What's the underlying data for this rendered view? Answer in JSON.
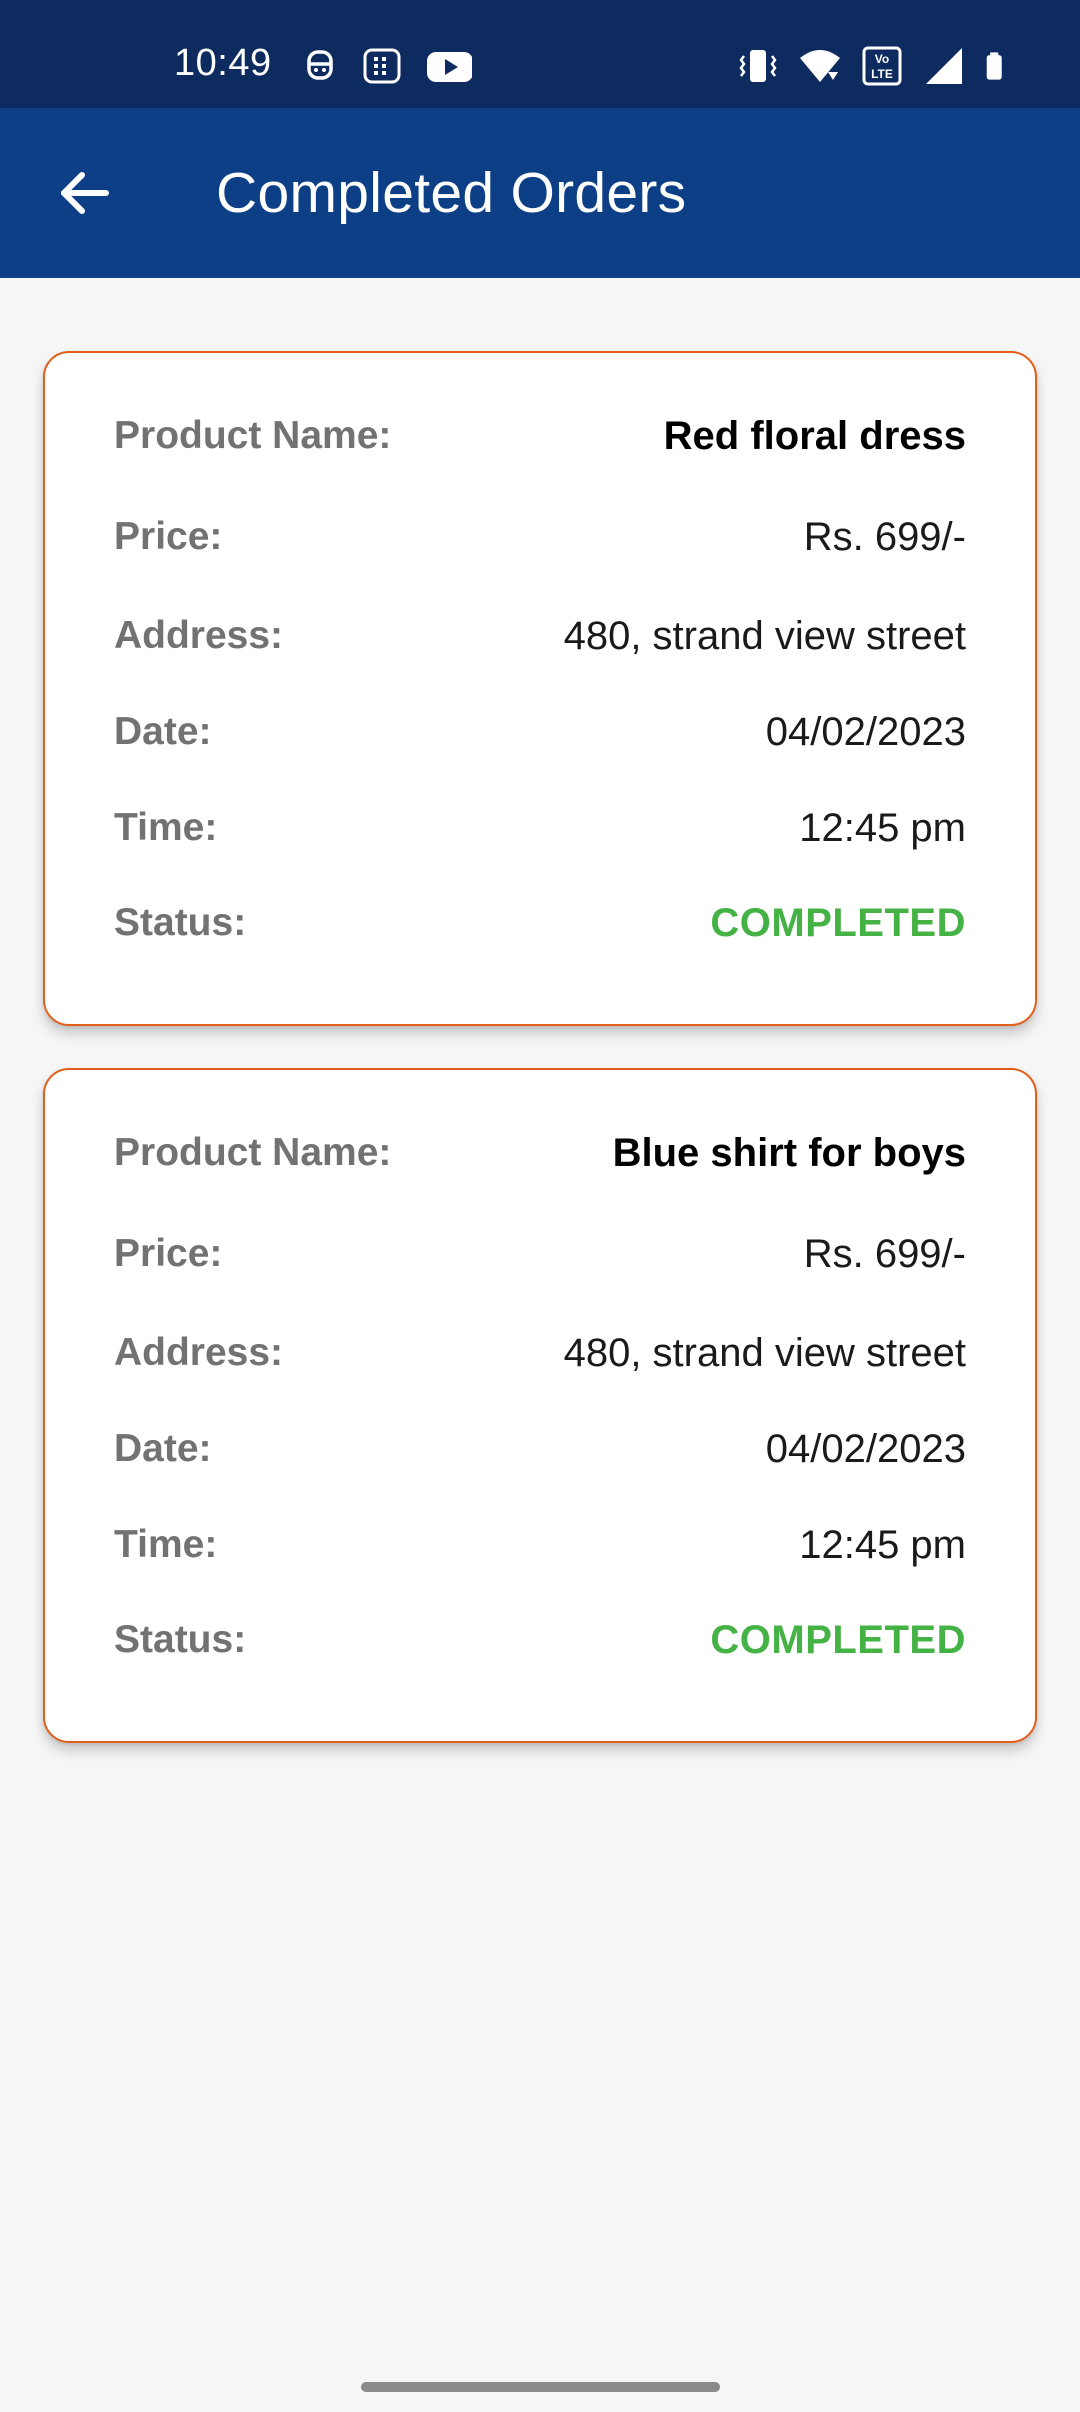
{
  "status_bar": {
    "time": "10:49",
    "left_icons": [
      "robot-face-icon",
      "chat-grid-icon",
      "youtube-icon"
    ],
    "right_icons": [
      "vibrate-icon",
      "wifi-icon",
      "volte-icon",
      "cell-signal-icon",
      "battery-icon"
    ],
    "volte_text": "VoLTE"
  },
  "app_bar": {
    "title": "Completed Orders",
    "back_icon": "arrow-back-icon",
    "background_color": "#0d3f87"
  },
  "orders": [
    {
      "product_name_label": "Product Name:",
      "product_name": "Red floral dress",
      "price_label": "Price:",
      "price": "Rs. 699/-",
      "address_label": "Address:",
      "address": "480, strand view street",
      "date_label": "Date:",
      "date": "04/02/2023",
      "time_label": "Time:",
      "time": "12:45 pm",
      "status_label": "Status:",
      "status": "COMPLETED"
    },
    {
      "product_name_label": "Product Name:",
      "product_name": "Blue shirt for boys",
      "price_label": "Price:",
      "price": "Rs. 699/-",
      "address_label": "Address:",
      "address": "480, strand view street",
      "date_label": "Date:",
      "date": "04/02/2023",
      "time_label": "Time:",
      "time": "12:45 pm",
      "status_label": "Status:",
      "status": "COMPLETED"
    }
  ],
  "colors": {
    "card_border": "#e25f1a",
    "status_completed": "#45b245",
    "label_gray": "#727272"
  }
}
